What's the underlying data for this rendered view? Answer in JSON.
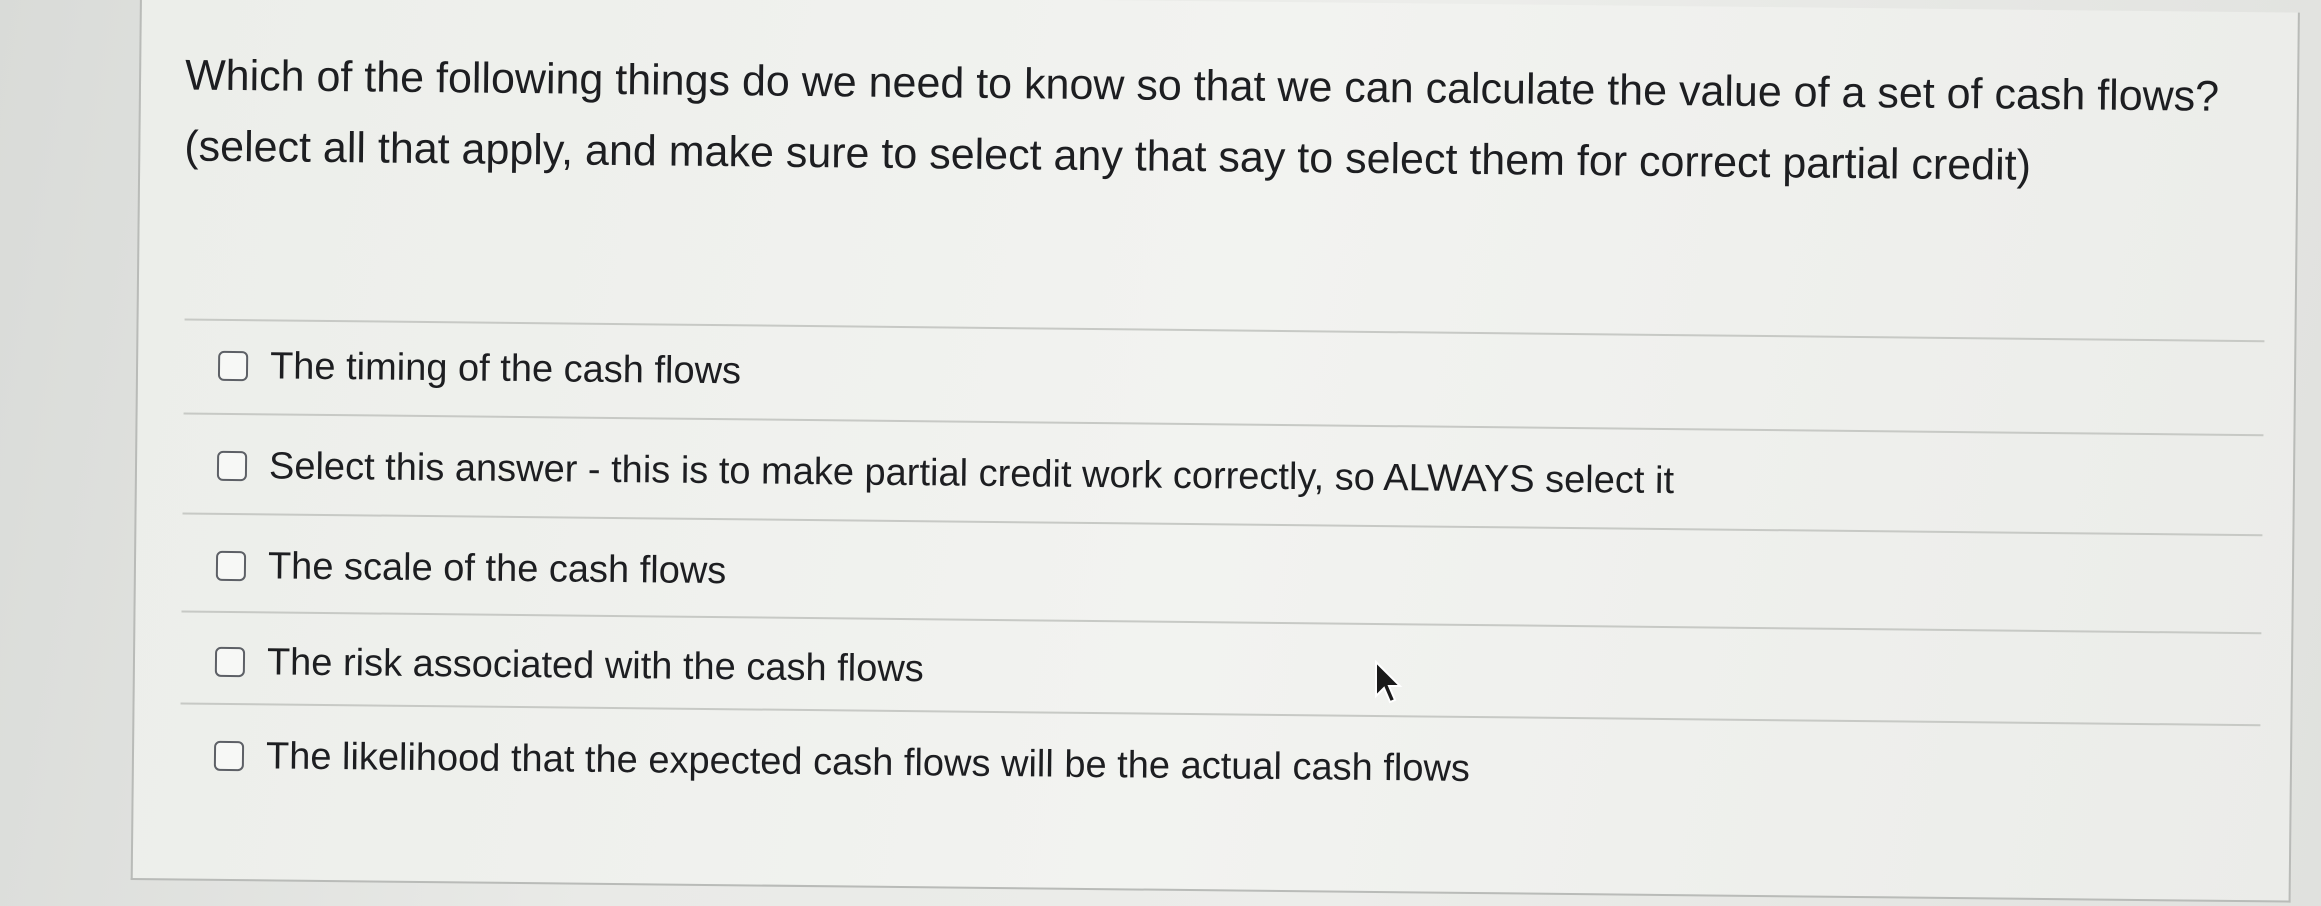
{
  "question": {
    "text": "Which of the following things do we need to know so that we can calculate the value of a set of cash flows? (select all that apply, and make sure to select any that say to select them for correct partial credit)"
  },
  "options": [
    {
      "label": "The timing of the cash flows",
      "checked": false
    },
    {
      "label": "Select this answer - this is to make partial credit work correctly, so ALWAYS select it",
      "checked": false
    },
    {
      "label": "The scale of the cash flows",
      "checked": false
    },
    {
      "label": "The risk associated with the cash flows",
      "checked": false
    },
    {
      "label": "The likelihood that the expected cash flows will be the actual cash flows",
      "checked": false
    }
  ],
  "icons": {
    "checkbox": "checkbox-unchecked-icon",
    "cursor": "mouse-pointer-icon"
  },
  "colors": {
    "text": "#1d1e21",
    "checkbox_border": "#5d6066",
    "divider": "#c7c9c5"
  }
}
